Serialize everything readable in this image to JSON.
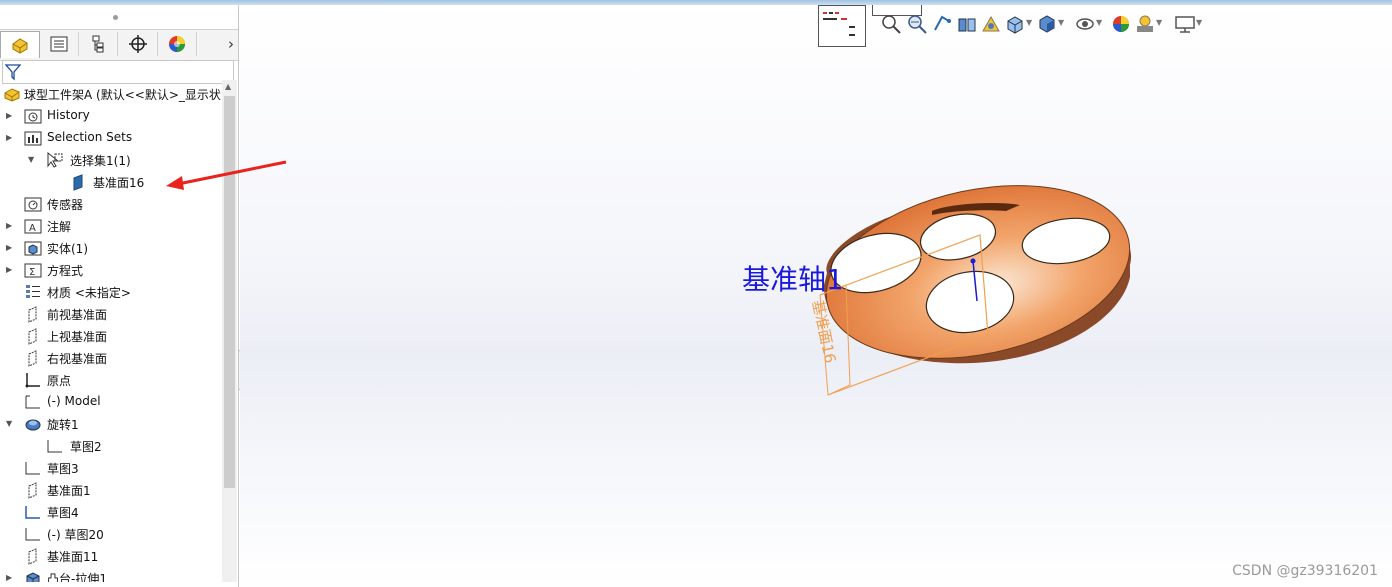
{
  "feature_tree": {
    "root": {
      "label": "球型工件架A  (默认<<默认>_显示状"
    },
    "items": [
      {
        "label": "History",
        "arrow": "▶",
        "icon": "history-folder-icon"
      },
      {
        "label": "Selection Sets",
        "arrow": "▶",
        "icon": "selection-sets-folder-icon"
      },
      {
        "label": "选择集1(1)",
        "arrow": "▼",
        "icon": "selection-set-icon"
      },
      {
        "label": "基准面16",
        "arrow": "",
        "icon": "plane-selected-icon"
      },
      {
        "label": "传感器",
        "arrow": "",
        "icon": "sensor-folder-icon"
      },
      {
        "label": "注解",
        "arrow": "▶",
        "icon": "annotations-folder-icon"
      },
      {
        "label": "实体(1)",
        "arrow": "▶",
        "icon": "solid-bodies-folder-icon"
      },
      {
        "label": "方程式",
        "arrow": "▶",
        "icon": "equations-folder-icon"
      },
      {
        "label": "材质 <未指定>",
        "arrow": "",
        "icon": "material-icon"
      },
      {
        "label": "前视基准面",
        "arrow": "",
        "icon": "plane-icon"
      },
      {
        "label": "上视基准面",
        "arrow": "",
        "icon": "plane-icon"
      },
      {
        "label": "右视基准面",
        "arrow": "",
        "icon": "plane-icon"
      },
      {
        "label": "原点",
        "arrow": "",
        "icon": "origin-icon"
      },
      {
        "label": "(-) Model",
        "arrow": "",
        "icon": "sketch-icon"
      },
      {
        "label": "旋转1",
        "arrow": "▼",
        "icon": "revolve-icon"
      },
      {
        "label": "草图2",
        "arrow": "",
        "icon": "sketch-icon"
      },
      {
        "label": "草图3",
        "arrow": "",
        "icon": "sketch-icon"
      },
      {
        "label": "基准面1",
        "arrow": "",
        "icon": "plane-icon"
      },
      {
        "label": "草图4",
        "arrow": "",
        "icon": "sketch-blue-icon"
      },
      {
        "label": "(-) 草图20",
        "arrow": "",
        "icon": "sketch-icon"
      },
      {
        "label": "基准面11",
        "arrow": "",
        "icon": "plane-icon"
      },
      {
        "label": "凸台-拉伸1",
        "arrow": "▶",
        "icon": "boss-extrude-icon"
      }
    ]
  },
  "panel_tabs": [
    {
      "name": "feature-manager-tab",
      "icon": "part-icon"
    },
    {
      "name": "property-manager-tab",
      "icon": "property-manager-icon"
    },
    {
      "name": "configuration-manager-tab",
      "icon": "configuration-icon"
    },
    {
      "name": "dimxpert-tab",
      "icon": "crosshair-icon"
    },
    {
      "name": "display-manager-tab",
      "icon": "appearance-icon"
    }
  ],
  "viewport": {
    "axis_label": "基准轴1",
    "plane_label": "基准面16",
    "watermark": "CSDN @gz39316201",
    "model_color": "#e07a3a"
  }
}
